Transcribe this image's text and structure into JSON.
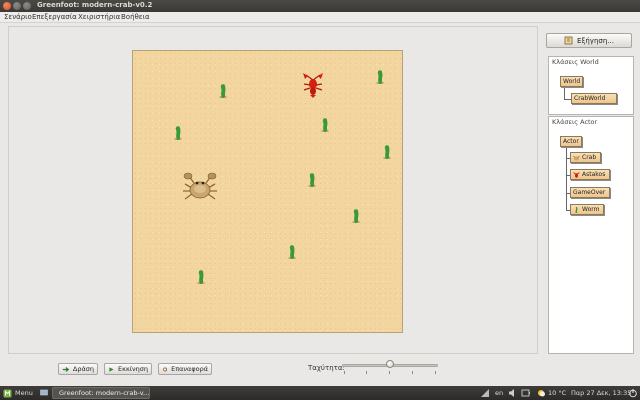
{
  "window": {
    "title": "Greenfoot: modern-crab-v0.2"
  },
  "menubar": {
    "items": [
      "Σενάριο",
      "Επεξεργασία",
      "Χειριστήρια",
      "Βοήθεια"
    ]
  },
  "controls": {
    "act_label": "Δράση",
    "run_label": "Εκκίνηση",
    "reset_label": "Επαναφορά",
    "speed_label": "Ταχύτητα:",
    "speed_fraction": 0.5
  },
  "right_panel": {
    "explain_label": "Εξήγηση...",
    "world_classes_header": "Κλάσεις World",
    "world_classes": [
      "World",
      "CrabWorld"
    ],
    "actor_classes_header": "Κλάσεις Actor",
    "actor_classes": [
      "Actor",
      "Crab",
      "Astakos",
      "GameOver",
      "Worm"
    ]
  },
  "taskbar": {
    "menu_label": "Menu",
    "window_label": "Greenfoot: modern-crab-v...",
    "keyboard_layout": "en",
    "temperature": "10 °C",
    "datetime": "Παρ 27 Δεκ, 13:35"
  },
  "colors": {
    "sand": "#f3d5a0",
    "worm": "#3a9a3a",
    "crab": "#c8a66e",
    "lobster": "#d42010",
    "class_node": "#f0c48a"
  },
  "world_actors": {
    "worms": 9,
    "crabs": 1,
    "lobsters": 1
  }
}
